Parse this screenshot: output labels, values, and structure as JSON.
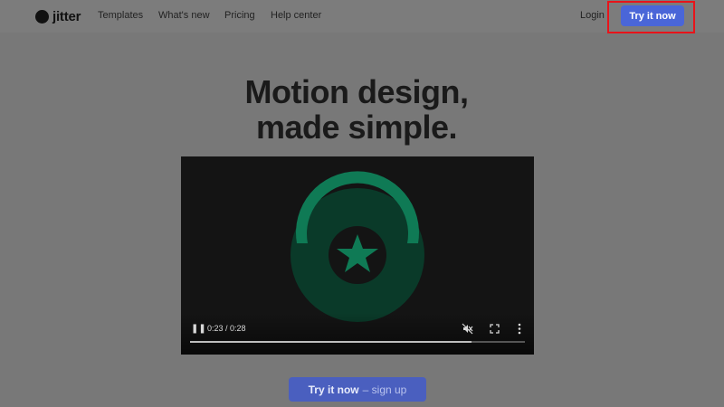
{
  "header": {
    "logo_text": "jitter",
    "nav": [
      "Templates",
      "What's new",
      "Pricing",
      "Help center"
    ],
    "login": "Login",
    "try_button": "Try it now"
  },
  "hero": {
    "title_line1": "Motion design,",
    "title_line2": "made simple."
  },
  "video": {
    "time": "0:23 / 0:28",
    "progress": 0.84,
    "icons": [
      "pause-icon",
      "mute-icon",
      "fullscreen-icon",
      "more-icon"
    ]
  },
  "cta": {
    "label": "Try it now",
    "sub": "– sign up"
  },
  "colors": {
    "accent": "#4a66d8",
    "highlight": "#e8141a",
    "video_green": "#0f7a55"
  }
}
